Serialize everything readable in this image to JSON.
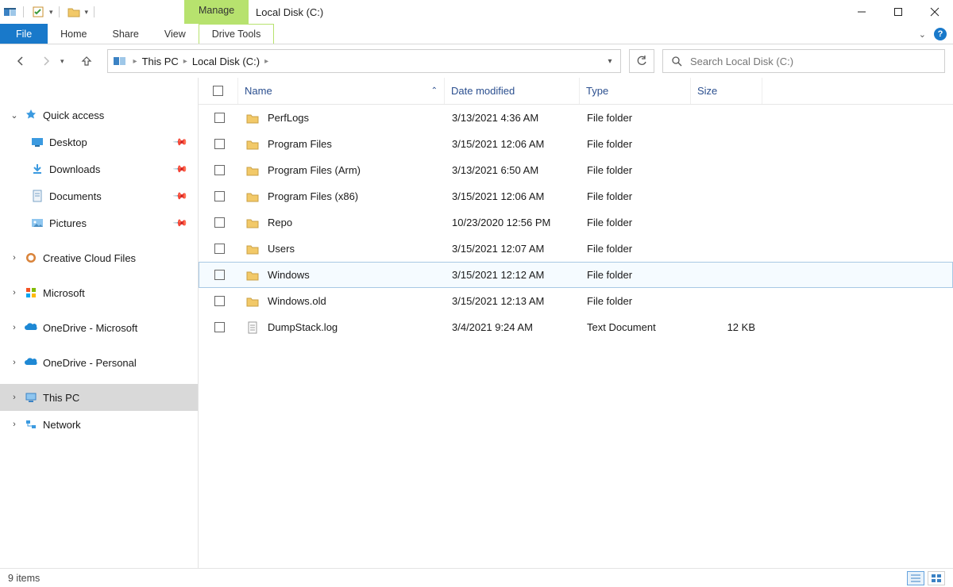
{
  "window": {
    "title": "Local Disk (C:)",
    "contextual_tab": "Manage"
  },
  "ribbon": {
    "file": "File",
    "tabs": [
      "Home",
      "Share",
      "View"
    ],
    "context_tabs": [
      "Drive Tools"
    ]
  },
  "address": {
    "segments": [
      "This PC",
      "Local Disk (C:)"
    ]
  },
  "search": {
    "placeholder": "Search Local Disk (C:)"
  },
  "tree": {
    "quickaccess": {
      "label": "Quick access",
      "expanded": true
    },
    "qa_items": [
      {
        "label": "Desktop",
        "pinned": true,
        "icon": "desktop"
      },
      {
        "label": "Downloads",
        "pinned": true,
        "icon": "downloads"
      },
      {
        "label": "Documents",
        "pinned": true,
        "icon": "documents"
      },
      {
        "label": "Pictures",
        "pinned": true,
        "icon": "pictures"
      }
    ],
    "items": [
      {
        "label": "Creative Cloud Files",
        "icon": "ccloud"
      },
      {
        "label": "Microsoft",
        "icon": "ms"
      },
      {
        "label": "OneDrive - Microsoft",
        "icon": "onedrive"
      },
      {
        "label": "OneDrive - Personal",
        "icon": "onedrive"
      },
      {
        "label": "This PC",
        "icon": "pc",
        "selected": true
      },
      {
        "label": "Network",
        "icon": "network"
      }
    ]
  },
  "list": {
    "columns": {
      "name": "Name",
      "date": "Date modified",
      "type": "Type",
      "size": "Size"
    },
    "rows": [
      {
        "name": "PerfLogs",
        "date": "3/13/2021 4:36 AM",
        "type": "File folder",
        "size": "",
        "icon": "folder"
      },
      {
        "name": "Program Files",
        "date": "3/15/2021 12:06 AM",
        "type": "File folder",
        "size": "",
        "icon": "folder"
      },
      {
        "name": "Program Files (Arm)",
        "date": "3/13/2021 6:50 AM",
        "type": "File folder",
        "size": "",
        "icon": "folder"
      },
      {
        "name": "Program Files (x86)",
        "date": "3/15/2021 12:06 AM",
        "type": "File folder",
        "size": "",
        "icon": "folder"
      },
      {
        "name": "Repo",
        "date": "10/23/2020 12:56 PM",
        "type": "File folder",
        "size": "",
        "icon": "folder"
      },
      {
        "name": "Users",
        "date": "3/15/2021 12:07 AM",
        "type": "File folder",
        "size": "",
        "icon": "folder"
      },
      {
        "name": "Windows",
        "date": "3/15/2021 12:12 AM",
        "type": "File folder",
        "size": "",
        "icon": "folder",
        "hovered": true
      },
      {
        "name": "Windows.old",
        "date": "3/15/2021 12:13 AM",
        "type": "File folder",
        "size": "",
        "icon": "folder"
      },
      {
        "name": "DumpStack.log",
        "date": "3/4/2021 9:24 AM",
        "type": "Text Document",
        "size": "12 KB",
        "icon": "text"
      }
    ]
  },
  "status": {
    "left": "9 items"
  }
}
